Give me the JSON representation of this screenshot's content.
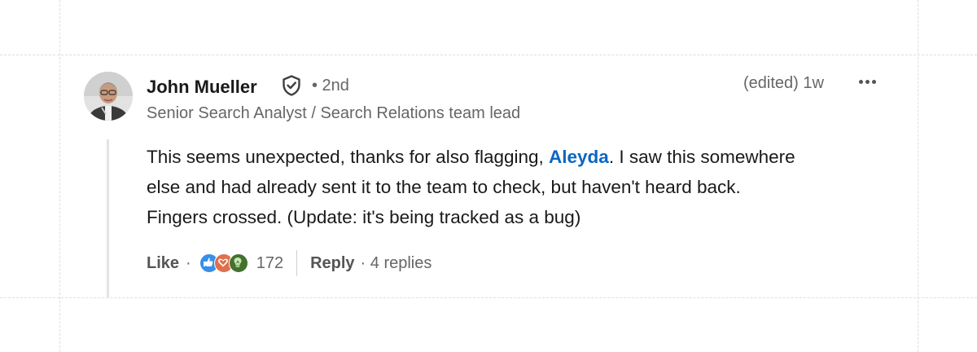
{
  "comment": {
    "author": {
      "name": "John Mueller",
      "connection_degree": "• 2nd",
      "headline": "Senior Search Analyst / Search Relations team lead"
    },
    "edited_label": "(edited)",
    "time_ago": "1w",
    "body": {
      "line1_before": "This seems unexpected, thanks for also flagging, ",
      "mention": "Aleyda",
      "line1_after": ". I saw this somewhere",
      "line2": "else and had already sent it to the team to check, but haven't heard back.",
      "line3": "Fingers crossed. (Update: it's being tracked as a bug)"
    },
    "actions": {
      "like_label": "Like",
      "separator": "·",
      "reactions": [
        "like-icon",
        "love-icon",
        "insightful-icon"
      ],
      "reaction_count": "172",
      "reply_label": "Reply",
      "replies_label": "· 4 replies"
    }
  },
  "colors": {
    "mention": "#0a66c2",
    "secondary_text": "#666666",
    "like_reaction": "#378fe9",
    "love_reaction": "#df704d",
    "insightful_reaction": "#44712e"
  }
}
